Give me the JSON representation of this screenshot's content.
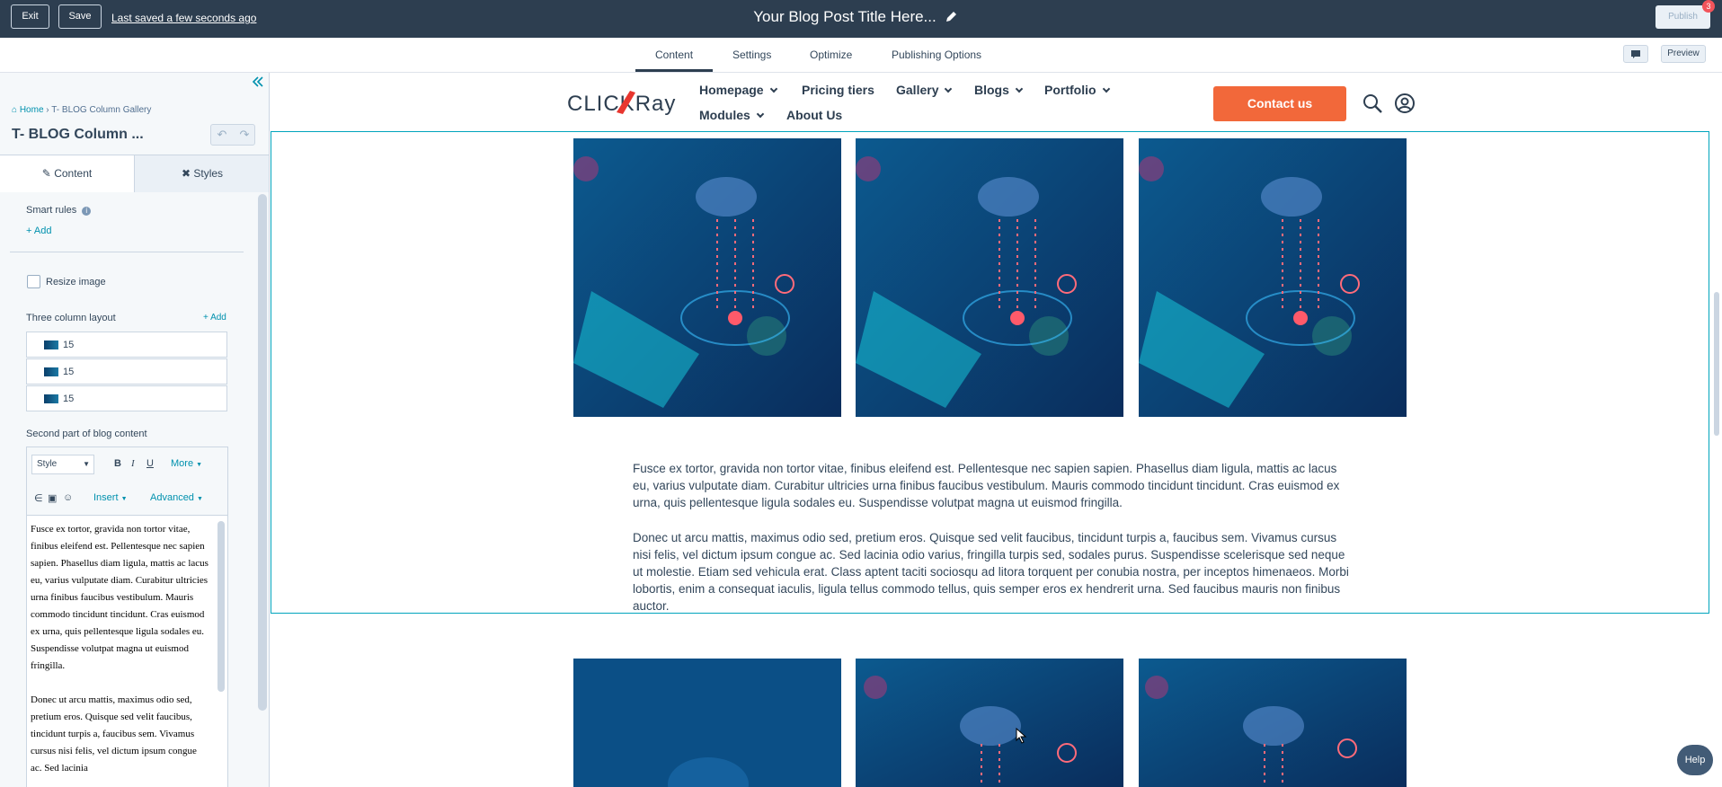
{
  "topbar": {
    "exit_label": "Exit",
    "save_label": "Save",
    "last_saved": "Last saved a few seconds ago",
    "title": "Your Blog Post Title Here...",
    "publish_label": "Publish",
    "notification_count": "3"
  },
  "main_tabs": [
    "Content",
    "Settings",
    "Optimize",
    "Publishing Options"
  ],
  "preview_label": "Preview",
  "sidebar": {
    "breadcrumb": {
      "home": "Home",
      "current": "T- BLOG Column Gallery"
    },
    "module_title": "T- BLOG Column ...",
    "tabs": {
      "content": "Content",
      "styles": "Styles"
    },
    "smart_rules_label": "Smart rules",
    "add_label": "Add",
    "resize_image_label": "Resize image",
    "three_col_label": "Three column layout",
    "three_col_add": "+ Add",
    "columns": [
      "15",
      "15",
      "15"
    ],
    "second_part_label": "Second part of blog content",
    "rte": {
      "style_placeholder": "Style",
      "more_label": "More",
      "insert_label": "Insert",
      "advanced_label": "Advanced",
      "p1": "Fusce ex tortor, gravida non tortor vitae, finibus eleifend est. Pellentesque nec sapien sapien. Phasellus diam ligula, mattis ac lacus eu, varius vulputate diam. Curabitur ultricies urna finibus faucibus vestibulum. Mauris commodo tincidunt tincidunt. Cras euismod ex urna, quis pellentesque ligula sodales eu. Suspendisse volutpat magna ut euismod fringilla.",
      "p2": "Donec ut arcu mattis, maximus odio sed, pretium eros. Quisque sed velit faucibus, tincidunt turpis a, faucibus sem. Vivamus cursus nisi felis, vel dictum ipsum congue ac. Sed lacinia"
    }
  },
  "site": {
    "logo_text": "CLICKRay",
    "nav": {
      "homepage": "Homepage",
      "pricing": "Pricing tiers",
      "gallery": "Gallery",
      "blogs": "Blogs",
      "portfolio": "Portfolio",
      "modules": "Modules",
      "about": "About Us"
    },
    "contact_label": "Contact us"
  },
  "content": {
    "p1": "Fusce ex tortor, gravida non tortor vitae, finibus eleifend est. Pellentesque nec sapien sapien. Phasellus diam ligula, mattis ac lacus eu, varius vulputate diam. Curabitur ultricies urna finibus faucibus vestibulum. Mauris commodo tincidunt tincidunt. Cras euismod ex urna, quis pellentesque ligula sodales eu. Suspendisse volutpat magna ut euismod fringilla.",
    "p2": "Donec ut arcu mattis, maximus odio sed, pretium eros. Quisque sed velit faucibus, tincidunt turpis a, faucibus sem. Vivamus cursus nisi felis, vel dictum ipsum congue ac. Sed lacinia odio varius, fringilla turpis sed, sodales purus. Suspendisse scelerisque sed neque ut molestie. Etiam sed vehicula erat. Class aptent taciti sociosqu ad litora torquent per conubia nostra, per inceptos himenaeos. Morbi lobortis, enim a consequat iaculis, ligula tellus commodo tellus, quis semper eros ex hendrerit urna. Sed faucibus mauris non finibus auctor."
  },
  "help_label": "Help",
  "colors": {
    "topbar": "#2d3e50",
    "accent": "#f2683a",
    "selection": "#00a4bd",
    "link": "#0091ae"
  }
}
